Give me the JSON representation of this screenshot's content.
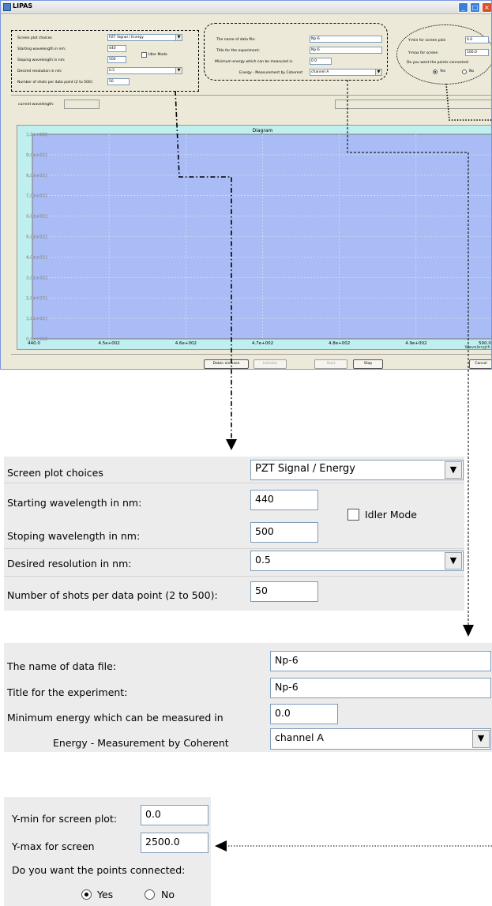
{
  "window": {
    "title": "LIPAS",
    "controls": [
      "_",
      "□",
      "×"
    ]
  },
  "settings": {
    "screen_plot_label": "Screen plot choices",
    "screen_plot_value": "PZT Signal / Energy",
    "start_label": "Starting wavelength in nm:",
    "start_value": "440",
    "stop_label": "Stoping wavelength in nm:",
    "stop_value": "500",
    "idler_label": "Idler Mode",
    "resolution_label": "Desired resolution in nm:",
    "resolution_value": "0.5",
    "shots_label": "Number of shots per data point (2 to 500):",
    "shots_value": "50"
  },
  "datafile": {
    "name_label": "The name of data file:",
    "name_value": "Np-6",
    "title_label": "Title for the experiment:",
    "title_value": "Np-6",
    "minenergy_label": "Minimum energy which can be measured in",
    "minenergy_value": "0.0",
    "energy_label": "Energy - Measurement by Coherent",
    "energy_value": "channel A"
  },
  "screen": {
    "ymin_label": "Y-min for screen plot:",
    "ymin_value": "0.0",
    "ymax_label_small": "Y-max for screen",
    "ymax_value_small": "100.0",
    "ymax_label": "Y-max for screen",
    "ymax_value": "2500.0",
    "connected_label": "Do you want the points connected:",
    "connected_label_small": "Do you want the points connected:",
    "yes_label": "Yes",
    "no_label": "No"
  },
  "status": {
    "current_wavelength_label": "current wavelength:",
    "current_wavelength_value": ""
  },
  "buttons": {
    "load": "Daten einlesen",
    "init": "Initialize",
    "start": "Start",
    "stop": "Stop",
    "cancel": "Cancel"
  },
  "chart_data": {
    "type": "line",
    "title": "Diagram",
    "xlabel": "Wavelength",
    "ylabel": "",
    "x_ticks": [
      "440.0",
      "4.5e+002",
      "4.6e+002",
      "4.7e+002",
      "4.8e+002",
      "4.9e+002",
      "500.0"
    ],
    "y_ticks": [
      "0.0e+000",
      "1.0e+001",
      "2.0e+001",
      "3.0e+001",
      "4.0e+001",
      "5.0e+001",
      "6.0e+001",
      "7.0e+001",
      "8.0e+001",
      "9.0e+001",
      "1.0e+002"
    ],
    "xlim": [
      440,
      500
    ],
    "ylim": [
      0,
      100
    ],
    "grid": true,
    "series": [],
    "colors": {
      "plot_bg": "#a9bcf5",
      "frame_bg": "#bfefef",
      "grid": "#e8e8e8"
    }
  }
}
